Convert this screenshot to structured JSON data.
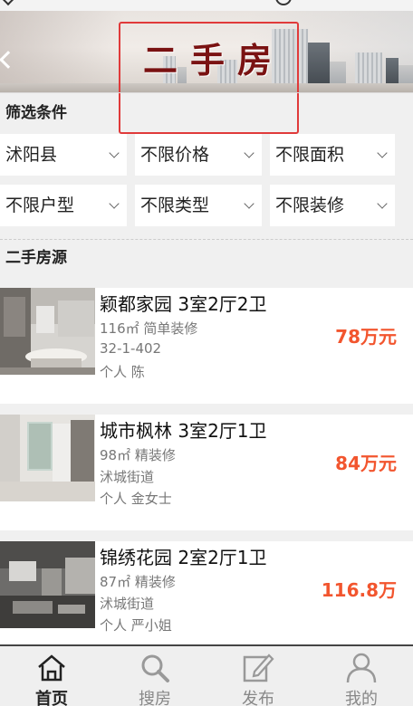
{
  "banner": {
    "title": "二手房"
  },
  "filters": {
    "heading": "筛选条件",
    "selects": [
      {
        "value": "沭阳县"
      },
      {
        "value": "不限价格"
      },
      {
        "value": "不限面积"
      },
      {
        "value": "不限户型"
      },
      {
        "value": "不限类型"
      },
      {
        "value": "不限装修"
      }
    ]
  },
  "listings": {
    "heading": "二手房源",
    "items": [
      {
        "title": "颖都家园 3室2厅2卫",
        "area_decor": "116㎡ 简单装修",
        "location": "32-1-402",
        "contact": "个人 陈",
        "price": "78万元"
      },
      {
        "title": "城市枫林 3室2厅1卫",
        "area_decor": "98㎡ 精装修",
        "location": "沭城街道",
        "contact": "个人 金女士",
        "price": "84万元"
      },
      {
        "title": "锦绣花园 2室2厅1卫",
        "area_decor": "87㎡ 精装修",
        "location": "沭城街道",
        "contact": "个人 严小姐",
        "price": "116.8万"
      }
    ]
  },
  "tabbar": {
    "tabs": [
      {
        "label": "首页",
        "icon": "home-icon",
        "active": true
      },
      {
        "label": "搜房",
        "icon": "search-icon",
        "active": false
      },
      {
        "label": "发布",
        "icon": "edit-icon",
        "active": false
      },
      {
        "label": "我的",
        "icon": "user-icon",
        "active": false
      }
    ]
  },
  "colors": {
    "price": "#f2552e",
    "highlight_box": "#e03a3a",
    "banner_title": "#7a1212"
  }
}
